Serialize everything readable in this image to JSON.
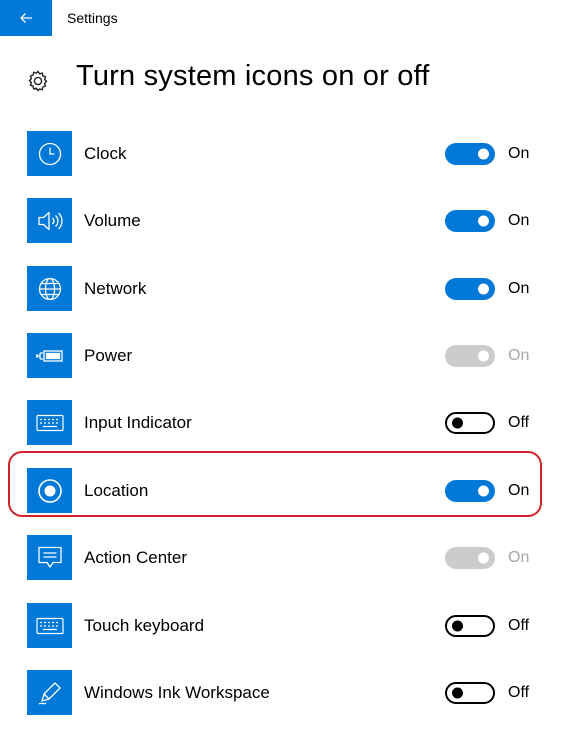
{
  "titlebar": {
    "back_icon": "arrow-left-icon",
    "title": "Settings"
  },
  "page": {
    "title": "Turn system icons on or off",
    "icon": "gear-icon"
  },
  "colors": {
    "accent": "#0078d7",
    "highlight": "#d2232a",
    "disabled": "#cccccc"
  },
  "items": [
    {
      "label": "Clock",
      "icon": "clock-icon",
      "state": "On",
      "toggle": "on"
    },
    {
      "label": "Volume",
      "icon": "volume-icon",
      "state": "On",
      "toggle": "on"
    },
    {
      "label": "Network",
      "icon": "globe-icon",
      "state": "On",
      "toggle": "on"
    },
    {
      "label": "Power",
      "icon": "power-icon",
      "state": "On",
      "toggle": "disabled"
    },
    {
      "label": "Input Indicator",
      "icon": "keyboard-icon",
      "state": "Off",
      "toggle": "off"
    },
    {
      "label": "Location",
      "icon": "location-icon",
      "state": "On",
      "toggle": "on",
      "highlighted": true
    },
    {
      "label": "Action Center",
      "icon": "action-center-icon",
      "state": "On",
      "toggle": "disabled"
    },
    {
      "label": "Touch keyboard",
      "icon": "keyboard-icon",
      "state": "Off",
      "toggle": "off"
    },
    {
      "label": "Windows Ink Workspace",
      "icon": "pen-icon",
      "state": "Off",
      "toggle": "off"
    }
  ]
}
